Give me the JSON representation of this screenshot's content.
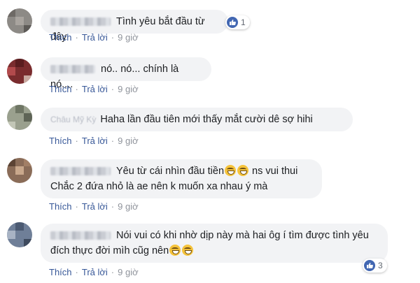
{
  "labels": {
    "like": "Thích",
    "reply": "Trả lời",
    "separator": "·"
  },
  "comments": [
    {
      "name": "Ngọc Hồng",
      "text": "Tình yêu bắt đầu từ đây",
      "time": "9 giờ",
      "reaction_count": "1"
    },
    {
      "name": "",
      "text": "nó.. nó... chính là nó....",
      "time": "9 giờ",
      "reaction_count": ""
    },
    {
      "name": "Châu Mỹ Kỳ",
      "text": "Haha lần đầu tiên mới thấy mắt cười dê sợ hihi",
      "time": "9 giờ",
      "reaction_count": ""
    },
    {
      "name": "",
      "text_line1_a": "Yêu từ cái nhìn đầu tiền",
      "text_line1_b": "ns vui thui",
      "text_line2": "Chắc 2 đứa nhỏ là ae nên k muốn xa nhau ý mà",
      "time": "9 giờ",
      "reaction_count": ""
    },
    {
      "name": "",
      "text_line1": "Nói vui có khi nhờ dịp này mà hai ôg í tìm được tình yêu",
      "text_line2": "đích thực đời mìh cũg nên",
      "time": "9 giờ",
      "reaction_count": "3"
    }
  ],
  "colors": {
    "bubble": "#f2f3f5",
    "link": "#385898",
    "meta": "#90949c",
    "like_badge": "#4267b2"
  },
  "icons": {
    "reaction": "like-thumb-icon",
    "emoji": "grinning-sweat-emoji-icon"
  }
}
